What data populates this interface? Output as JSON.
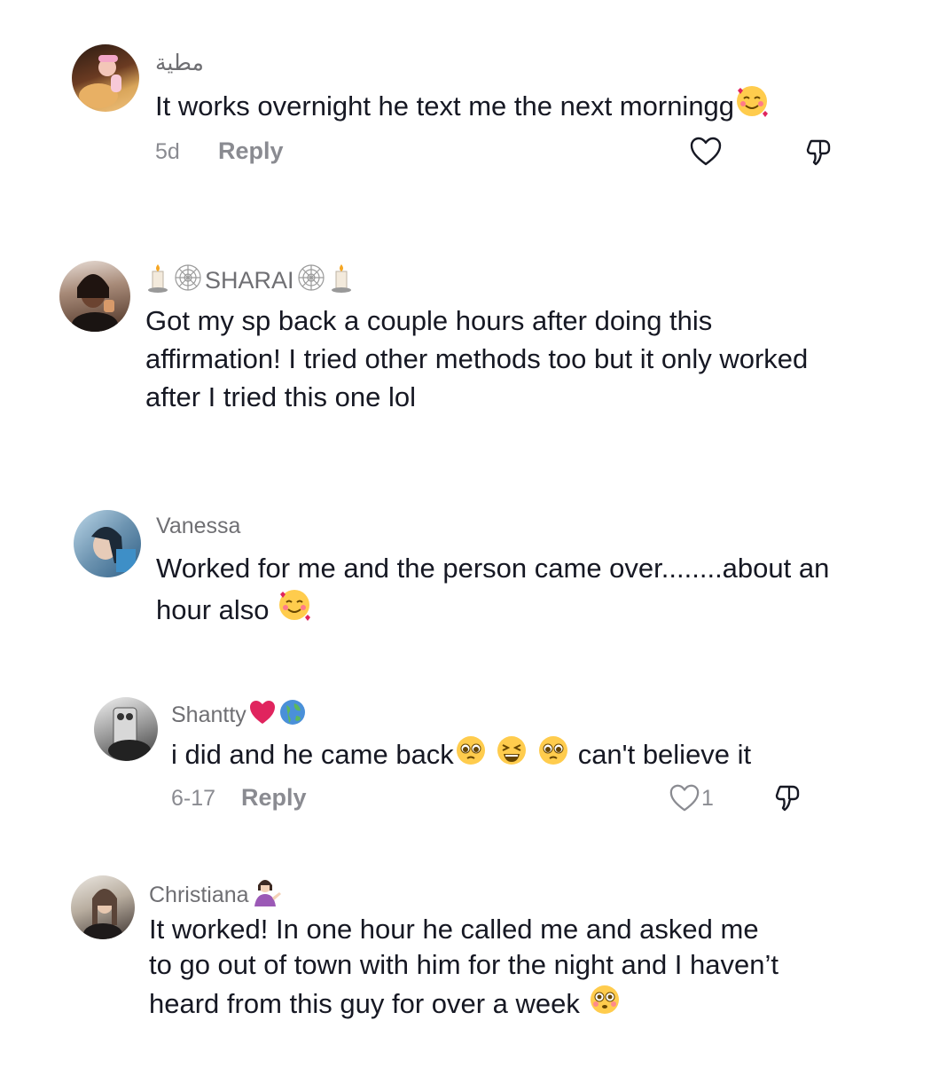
{
  "comments": [
    {
      "username": "مطية",
      "text": "It works overnight he text me the next morningg",
      "emoji_after": "smiling-hearts-emoji",
      "time": "5d",
      "reply_label": "Reply"
    },
    {
      "username": "SHARAI",
      "username_icons": [
        "candle-icon",
        "spiderweb-icon",
        "spiderweb-icon",
        "candle-icon"
      ],
      "text": "Got my sp back a couple hours after doing this affirmation! I tried other methods too but it only worked after I tried this one lol"
    },
    {
      "username": "Vanessa",
      "text": "Worked for me and the person came over........about an hour also",
      "emoji_after": "smiling-hearts-emoji"
    },
    {
      "username": "Shantty",
      "username_icons": [
        "red-heart-emoji",
        "globe-emoji"
      ],
      "text_part1": "i did and he came back",
      "text_part2": "can't believe it",
      "inline_emojis": [
        "pleading-face-emoji",
        "grinning-squinting-emoji",
        "pleading-face-emoji"
      ],
      "time": "6-17",
      "reply_label": "Reply",
      "likes": "1"
    },
    {
      "username": "Christiana",
      "username_icons": [
        "person-tipping-hand-emoji"
      ],
      "text": "It worked! In one hour he called me and asked me to go out of town with him for the night and I haven’t heard from this guy for over a week",
      "emoji_after": "flushed-face-emoji"
    }
  ],
  "colors": {
    "text": "#161823",
    "username": "#6f6f73",
    "meta": "#8a8b91",
    "heart_red": "#e0245e"
  }
}
